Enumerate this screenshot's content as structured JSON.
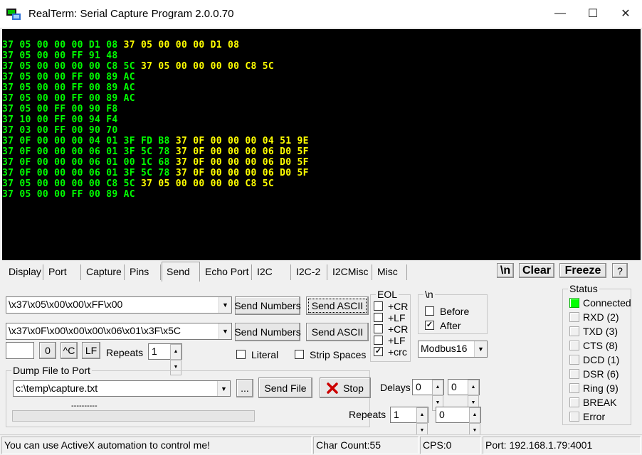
{
  "window": {
    "title": "RealTerm: Serial Capture Program  2.0.0.70",
    "icon": "realterm-app-icon",
    "min_glyph": "—",
    "max_glyph": "☐",
    "close_glyph": "✕"
  },
  "terminal": {
    "lines": [
      [
        {
          "t": "37 05 00 00 00 D1 08 ",
          "c": "g"
        },
        {
          "t": "37 05 00 00 00 D1 08",
          "c": "y"
        }
      ],
      [
        {
          "t": "37 05 00 00 FF 91 48",
          "c": "g"
        }
      ],
      [
        {
          "t": "37 05 00 00 00 00 C8 5C ",
          "c": "g"
        },
        {
          "t": "37 05 00 00 00 00 C8 5C",
          "c": "y"
        }
      ],
      [
        {
          "t": "37 05 00 00 FF 00 89 AC",
          "c": "g"
        }
      ],
      [
        {
          "t": "37 05 00 00 FF 00 89 AC",
          "c": "g"
        }
      ],
      [
        {
          "t": "37 05 00 00 FF 00 89 AC",
          "c": "g"
        }
      ],
      [
        {
          "t": "37 05 00 FF 00 90 F8",
          "c": "g"
        }
      ],
      [
        {
          "t": "37 10 00 FF 00 94 F4",
          "c": "g"
        }
      ],
      [
        {
          "t": "37 03 00 FF 00 90 70",
          "c": "g"
        }
      ],
      [
        {
          "t": "37 0F 00 00 00 04 01 3F FD B8 ",
          "c": "g"
        },
        {
          "t": "37 0F 00 00 00 04 51 9E",
          "c": "y"
        }
      ],
      [
        {
          "t": "37 0F 00 00 00 06 01 3F 5C 78 ",
          "c": "g"
        },
        {
          "t": "37 0F 00 00 00 06 D0 5F",
          "c": "y"
        }
      ],
      [
        {
          "t": "37 0F 00 00 00 06 01 00 1C 68 ",
          "c": "g"
        },
        {
          "t": "37 0F 00 00 00 06 D0 5F",
          "c": "y"
        }
      ],
      [
        {
          "t": "37 0F 00 00 00 06 01 3F 5C 78 ",
          "c": "g"
        },
        {
          "t": "37 0F 00 00 00 06 D0 5F",
          "c": "y"
        }
      ],
      [
        {
          "t": "37 05 00 00 00 00 C8 5C ",
          "c": "g"
        },
        {
          "t": "37 05 00 00 00 00 C8 5C",
          "c": "y"
        }
      ],
      [
        {
          "t": "37 05 00 00 FF 00 89 AC",
          "c": "g"
        }
      ]
    ]
  },
  "tabs": [
    "Display",
    "Port",
    "Capture",
    "Pins",
    "Send",
    "Echo Port",
    "I2C",
    "I2C-2",
    "I2CMisc",
    "Misc"
  ],
  "active_tab": "Send",
  "top_buttons": {
    "newline": "\\n",
    "clear": "Clear",
    "freeze": "Freeze",
    "help": "?"
  },
  "send": {
    "input1": "\\x37\\x05\\x00\\x00\\xFF\\x00",
    "input2": "\\x37\\x0F\\x00\\x00\\x00\\x06\\x01\\x3F\\x5C",
    "send_numbers_label": "Send Numbers",
    "send_ascii_label": "Send ASCII",
    "char_field": "",
    "zero_label": "0",
    "ctrl_c_label": "^C",
    "lf_label": "LF",
    "repeats_label": "Repeats",
    "repeats_value": "1",
    "literal_label": "Literal",
    "strip_spaces_label": "Strip Spaces"
  },
  "eol": {
    "legend": "EOL",
    "options": [
      {
        "label": "+CR",
        "checked": false
      },
      {
        "label": "+LF",
        "checked": false
      },
      {
        "label": "+CR",
        "checked": false
      },
      {
        "label": "+LF",
        "checked": false
      },
      {
        "label": "+crc",
        "checked": true
      }
    ]
  },
  "newline_group": {
    "legend": "\\n",
    "before_label": "Before",
    "before_checked": false,
    "after_label": "After",
    "after_checked": true
  },
  "crc_select": "Modbus16",
  "dump": {
    "legend": "Dump File to Port",
    "file": "c:\\temp\\capture.txt",
    "browse_label": "...",
    "send_file_label": "Send File",
    "stop_label": "Stop",
    "progress_text": "----------",
    "delays_label": "Delays",
    "delay1": "0",
    "delay2": "0",
    "repeats_label": "Repeats",
    "repeats1": "1",
    "repeats2": "0"
  },
  "status": {
    "legend": "Status",
    "items": [
      {
        "label": "Connected",
        "on": true
      },
      {
        "label": "RXD (2)",
        "on": false
      },
      {
        "label": "TXD (3)",
        "on": false
      },
      {
        "label": "CTS (8)",
        "on": false
      },
      {
        "label": "DCD (1)",
        "on": false
      },
      {
        "label": "DSR (6)",
        "on": false
      },
      {
        "label": "Ring (9)",
        "on": false
      },
      {
        "label": "BREAK",
        "on": false
      },
      {
        "label": "Error",
        "on": false
      }
    ]
  },
  "statusbar": {
    "message": "You can use ActiveX automation to control me!",
    "char_count": "Char Count:55",
    "cps": "CPS:0",
    "port": "Port: 192.168.1.79:4001"
  },
  "colors": {
    "terminal_bg": "#000000",
    "rx_text": "#00ff00",
    "tx_text": "#ffff00",
    "connected_led": "#00ff00",
    "stop_icon": "#cc0000"
  }
}
